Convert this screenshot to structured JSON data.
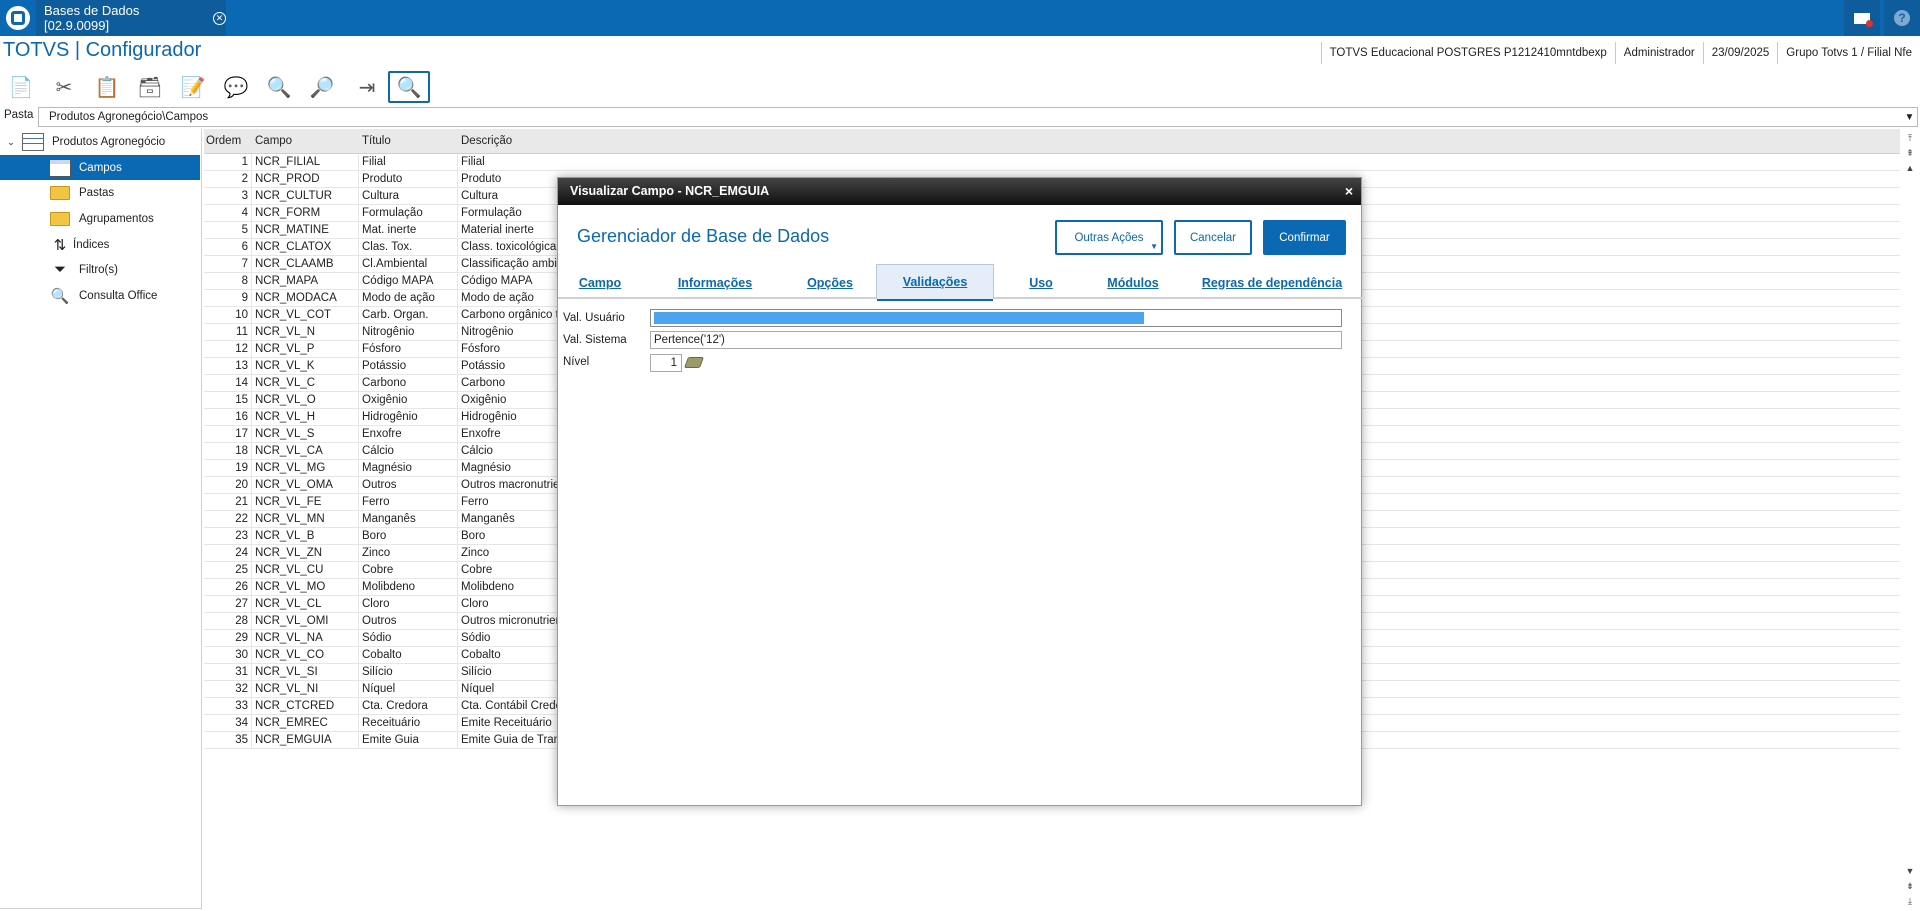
{
  "window": {
    "tab_title": "Bases de Dados [02.9.0099]",
    "close_glyph": "✕"
  },
  "header": {
    "app_title": "TOTVS | Configurador",
    "info": [
      "TOTVS Educacional POSTGRES P1212410mntdbexp",
      "Administrador",
      "23/09/2025",
      "Grupo Totvs 1 / Filial Nfe"
    ]
  },
  "toolbar": {
    "icons": [
      "copy-icon",
      "cut-icon",
      "paste-icon",
      "database-icon",
      "edit-icon",
      "help-icon",
      "search-icon",
      "search-next-icon",
      "exit-icon",
      "view-icon"
    ]
  },
  "path": {
    "label": "Pasta",
    "value": "Produtos Agronegócio\\Campos"
  },
  "tree": {
    "root_label": "Produtos Agronegócio",
    "items": [
      {
        "label": "Campos",
        "icon": "table-icon"
      },
      {
        "label": "Pastas",
        "icon": "folder-icon"
      },
      {
        "label": "Agrupamentos",
        "icon": "folder-icon"
      },
      {
        "label": "Índices",
        "icon": "sort-icon"
      },
      {
        "label": "Filtro(s)",
        "icon": "filter-icon"
      },
      {
        "label": "Consulta Office",
        "icon": "magnifier-icon"
      }
    ]
  },
  "grid": {
    "headers": [
      "Ordem",
      "Campo",
      "Título",
      "Descrição"
    ],
    "rows": [
      [
        "1",
        "NCR_FILIAL",
        "Filial",
        "Filial"
      ],
      [
        "2",
        "NCR_PROD",
        "Produto",
        "Produto"
      ],
      [
        "3",
        "NCR_CULTUR",
        "Cultura",
        "Cultura"
      ],
      [
        "4",
        "NCR_FORM",
        "Formulação",
        "Formulação"
      ],
      [
        "5",
        "NCR_MATINE",
        "Mat. inerte",
        "Material inerte"
      ],
      [
        "6",
        "NCR_CLATOX",
        "Clas. Tox.",
        "Class. toxicológica"
      ],
      [
        "7",
        "NCR_CLAAMB",
        "Cl.Ambiental",
        "Classificação ambie"
      ],
      [
        "8",
        "NCR_MAPA",
        "Código MAPA",
        "Código MAPA"
      ],
      [
        "9",
        "NCR_MODACA",
        "Modo de ação",
        "Modo de ação"
      ],
      [
        "10",
        "NCR_VL_COT",
        "Carb. Organ.",
        "Carbono orgânico to"
      ],
      [
        "11",
        "NCR_VL_N",
        "Nitrogênio",
        "Nitrogênio"
      ],
      [
        "12",
        "NCR_VL_P",
        "Fósforo",
        "Fósforo"
      ],
      [
        "13",
        "NCR_VL_K",
        "Potássio",
        "Potássio"
      ],
      [
        "14",
        "NCR_VL_C",
        "Carbono",
        "Carbono"
      ],
      [
        "15",
        "NCR_VL_O",
        "Oxigênio",
        "Oxigênio"
      ],
      [
        "16",
        "NCR_VL_H",
        "Hidrogênio",
        "Hidrogênio"
      ],
      [
        "17",
        "NCR_VL_S",
        "Enxofre",
        "Enxofre"
      ],
      [
        "18",
        "NCR_VL_CA",
        "Cálcio",
        "Cálcio"
      ],
      [
        "19",
        "NCR_VL_MG",
        "Magnésio",
        "Magnésio"
      ],
      [
        "20",
        "NCR_VL_OMA",
        "Outros",
        "Outros macronutrien"
      ],
      [
        "21",
        "NCR_VL_FE",
        "Ferro",
        "Ferro"
      ],
      [
        "22",
        "NCR_VL_MN",
        "Manganês",
        "Manganês"
      ],
      [
        "23",
        "NCR_VL_B",
        "Boro",
        "Boro"
      ],
      [
        "24",
        "NCR_VL_ZN",
        "Zinco",
        "Zinco"
      ],
      [
        "25",
        "NCR_VL_CU",
        "Cobre",
        "Cobre"
      ],
      [
        "26",
        "NCR_VL_MO",
        "Molibdeno",
        "Molibdeno"
      ],
      [
        "27",
        "NCR_VL_CL",
        "Cloro",
        "Cloro"
      ],
      [
        "28",
        "NCR_VL_OMI",
        "Outros",
        "Outros micronutrien"
      ],
      [
        "29",
        "NCR_VL_NA",
        "Sódio",
        "Sódio"
      ],
      [
        "30",
        "NCR_VL_CO",
        "Cobalto",
        "Cobalto"
      ],
      [
        "31",
        "NCR_VL_SI",
        "Silício",
        "Silício"
      ],
      [
        "32",
        "NCR_VL_NI",
        "Níquel",
        "Níquel"
      ],
      [
        "33",
        "NCR_CTCRED",
        "Cta. Credora",
        "Cta. Contábil Credo"
      ],
      [
        "34",
        "NCR_EMREC",
        "Receituário",
        "Emite Receituário"
      ],
      [
        "35",
        "NCR_EMGUIA",
        "Emite Guia",
        "Emite Guia de Trans"
      ]
    ]
  },
  "modal": {
    "title": "Visualizar Campo - NCR_EMGUIA",
    "close_glyph": "×",
    "heading": "Gerenciador de Base de Dados",
    "buttons": {
      "other": "Outras Ações",
      "cancel": "Cancelar",
      "confirm": "Confirmar"
    },
    "tabs": [
      "Campo",
      "Informações",
      "Opções",
      "Validações",
      "Uso",
      "Módulos",
      "Regras de dependência"
    ],
    "active_tab": "Validações",
    "fields": {
      "val_usuario_label": "Val. Usuário",
      "val_usuario_value": "",
      "val_sistema_label": "Val. Sistema",
      "val_sistema_value": "Pertence('12')",
      "nivel_label": "Nível",
      "nivel_value": "1"
    }
  },
  "colors": {
    "brand": "#0b68b2",
    "selection": "#4aa5ee"
  }
}
